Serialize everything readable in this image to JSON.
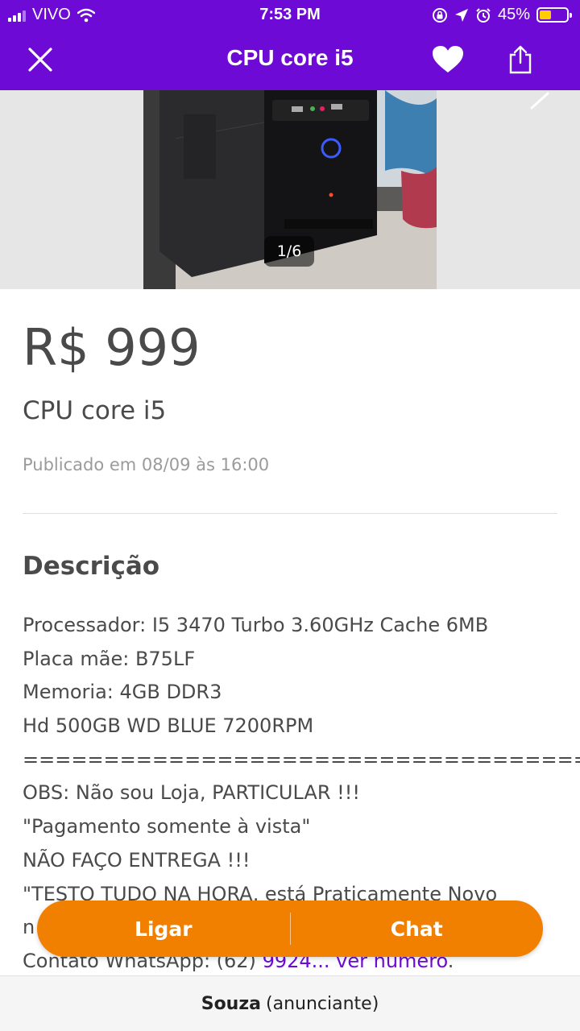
{
  "status_bar": {
    "carrier": "VIVO",
    "time": "7:53 PM",
    "battery_percent": "45%",
    "battery_level": 0.45,
    "icons": [
      "signal-icon",
      "wifi-icon",
      "orientation-lock-icon",
      "location-icon",
      "alarm-icon",
      "battery-icon"
    ]
  },
  "header": {
    "title": "CPU core i5",
    "icons": {
      "close": "close-icon",
      "favorite": "heart-icon",
      "share": "share-icon"
    }
  },
  "gallery": {
    "counter": "1/6",
    "image_description_icon": "photo-pc-tower"
  },
  "listing": {
    "price": "R$ 999",
    "title": "CPU core i5",
    "published": "Publicado em 08/09 às 16:00"
  },
  "description": {
    "heading": "Descrição",
    "lines": [
      "Processador: I5 3470 Turbo 3.60GHz Cache 6MB",
      "Placa mãe: B75LF",
      "Memoria: 4GB DDR3",
      "Hd 500GB WD BLUE 7200RPM",
      "===================================",
      "OBS: Não sou Loja, PARTICULAR !!!",
      "\"Pagamento somente à vista\"",
      "NÃO FAÇO ENTREGA !!!",
      "\"TESTO TUDO NA HORA, está Praticamente Novo",
      "n"
    ],
    "contact_prefix": "Contato WhatsApp: (62) ",
    "contact_link": "9924... ver número",
    "contact_suffix": "."
  },
  "actions": {
    "call": "Ligar",
    "chat": "Chat"
  },
  "footer": {
    "name": "Souza",
    "role": "(anunciante)"
  },
  "colors": {
    "brand_purple": "#6e0ad6",
    "action_orange": "#f28000",
    "battery_yellow": "#ffcc00"
  }
}
